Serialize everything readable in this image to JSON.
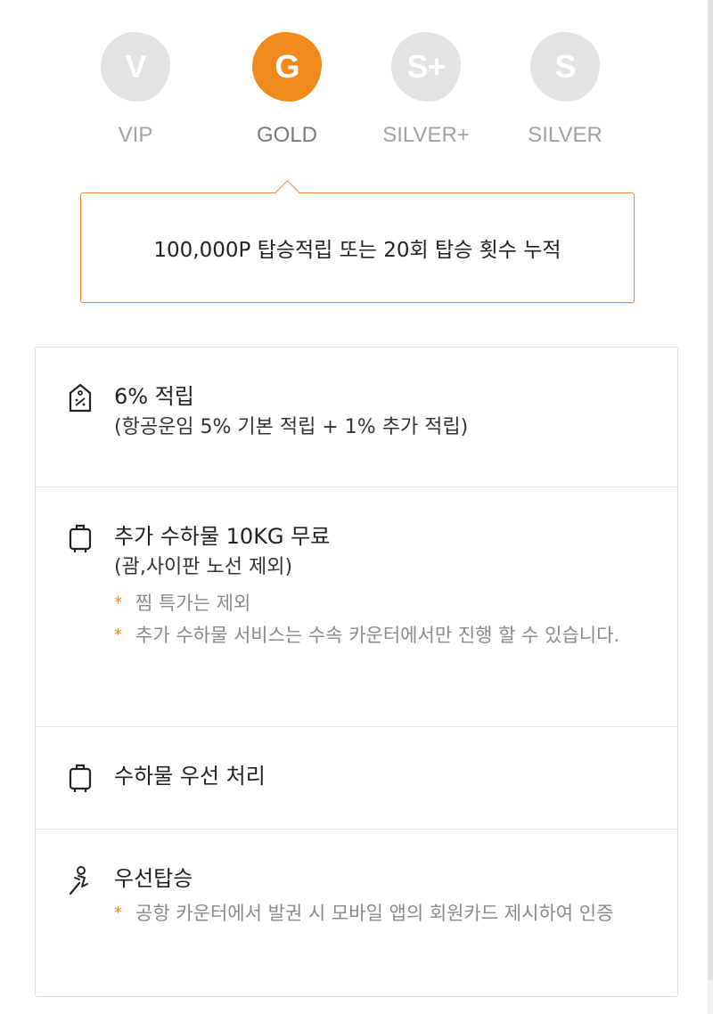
{
  "tiers": [
    {
      "badge": "V",
      "name": "VIP",
      "active": false
    },
    {
      "badge": "G",
      "name": "GOLD",
      "active": true
    },
    {
      "badge": "S+",
      "name": "SILVER+",
      "active": false
    },
    {
      "badge": "S",
      "name": "SILVER",
      "active": false
    }
  ],
  "requirement": {
    "text": "100,000P 탑승적립 또는 20회 탑승 횟수 누적"
  },
  "benefits": [
    {
      "icon": "tag-icon",
      "title": "6% 적립",
      "sub": "(항공운임 5% 기본 적립 + 1% 추가 적립)",
      "notes": []
    },
    {
      "icon": "luggage-icon",
      "title": "추가 수하물 10KG 무료",
      "sub": "(괌,사이판 노선 제외)",
      "notes": [
        "찜 특가는 제외",
        "추가 수하물 서비스는 수속 카운터에서만 진행 할 수 있습니다."
      ]
    },
    {
      "icon": "luggage-icon",
      "title": "수하물 우선 처리",
      "sub": "",
      "notes": []
    },
    {
      "icon": "seat-icon",
      "title": "우선탑승",
      "sub": "",
      "notes": [
        "공항 카운터에서 발권 시 모바일 앱의 회원카드 제시하여 인증"
      ]
    }
  ],
  "note_marker": "*",
  "colors": {
    "accent": "#f18a1c",
    "inactive_badge": "#e3e3e3",
    "note_text": "#8a8a8a"
  }
}
